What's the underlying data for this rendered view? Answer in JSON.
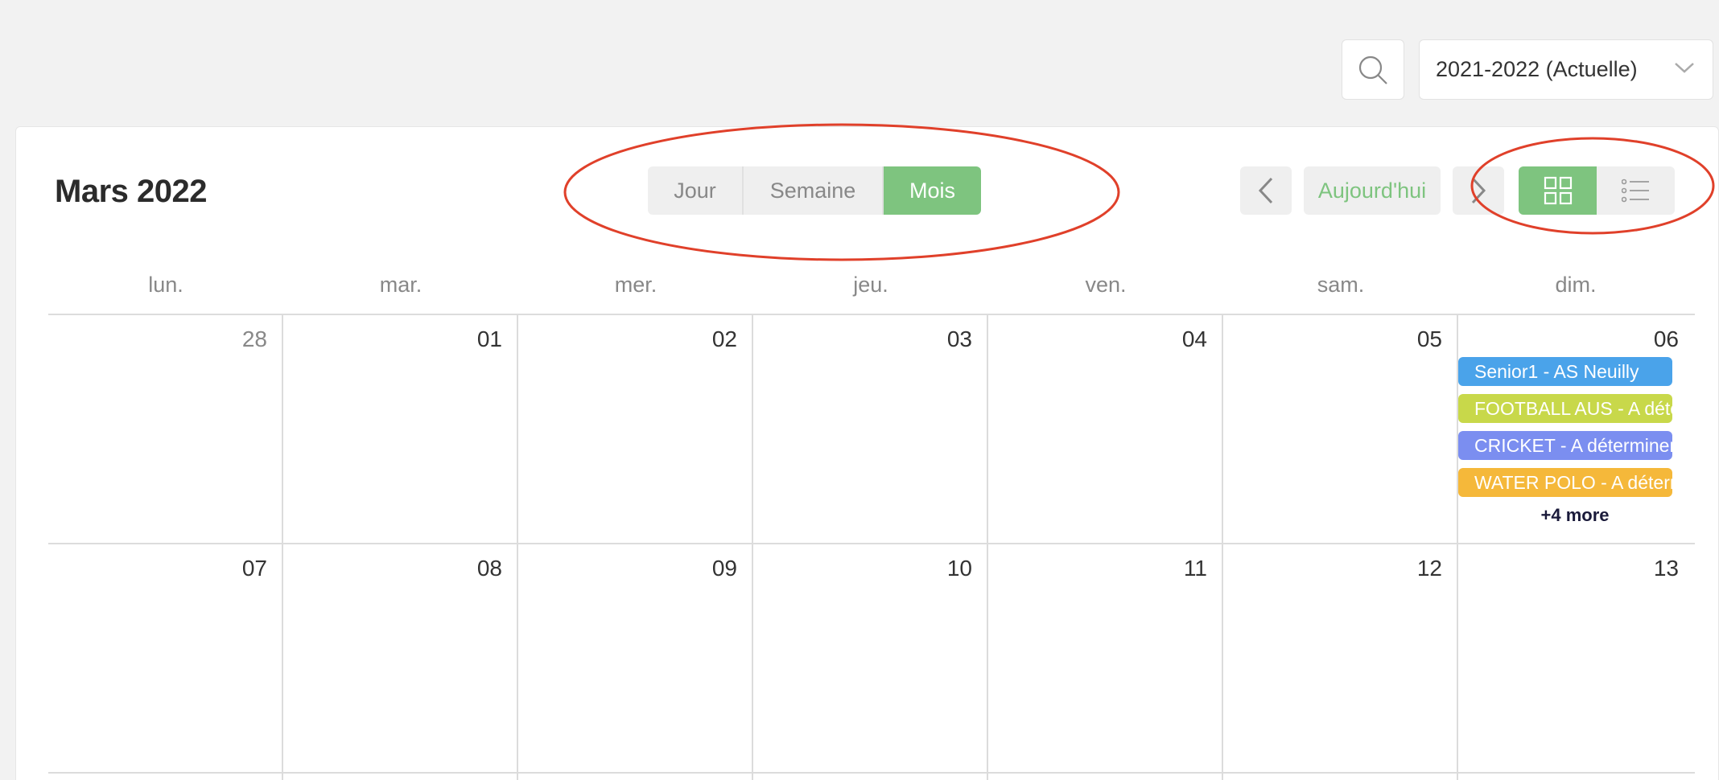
{
  "season": {
    "selected": "2021-2022 (Actuelle)"
  },
  "calendar": {
    "title": "Mars 2022",
    "views": [
      {
        "label": "Jour",
        "active": false
      },
      {
        "label": "Semaine",
        "active": false
      },
      {
        "label": "Mois",
        "active": true
      }
    ],
    "today_label": "Aujourd'hui",
    "weekdays": [
      "lun.",
      "mar.",
      "mer.",
      "jeu.",
      "ven.",
      "sam.",
      "dim."
    ],
    "weeks": [
      [
        "28",
        "01",
        "02",
        "03",
        "04",
        "05",
        "06"
      ],
      [
        "07",
        "08",
        "09",
        "10",
        "11",
        "12",
        "13"
      ]
    ],
    "events_06": [
      {
        "label": "Senior1 - AS Neuilly",
        "color": "#4aa3ea"
      },
      {
        "label": "FOOTBALL AUS - A déterminer",
        "color": "#c8d84a"
      },
      {
        "label": "CRICKET - A déterminer",
        "color": "#7b8ef0"
      },
      {
        "label": "WATER POLO - A déterminer",
        "color": "#f5b83a"
      }
    ],
    "more_label": "+4 more"
  },
  "colors": {
    "accent": "#7ec47f",
    "annotation": "#e0402a"
  }
}
